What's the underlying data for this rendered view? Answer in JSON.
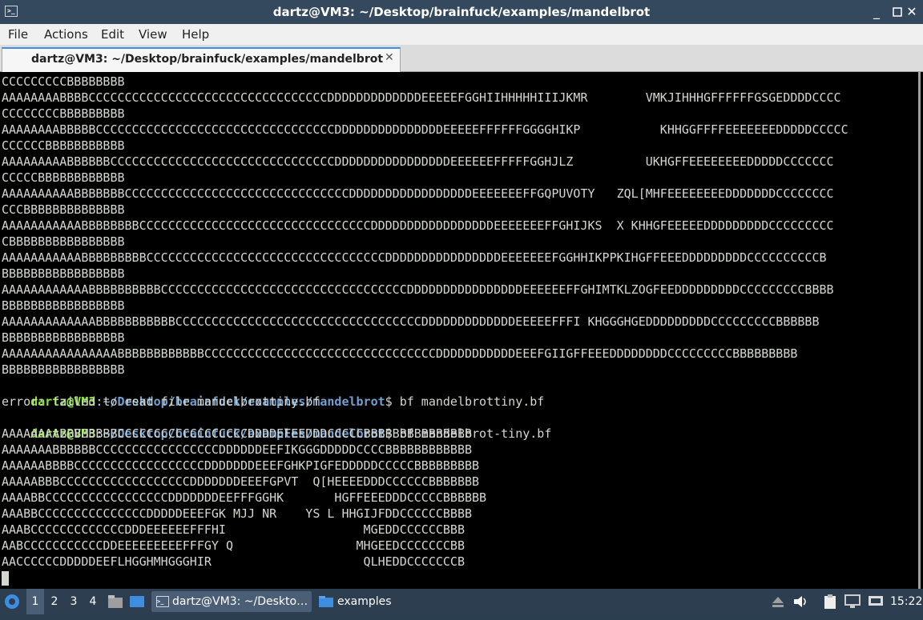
{
  "window": {
    "title": "dartz@VM3: ~/Desktop/brainfuck/examples/mandelbrot",
    "minimize": "_",
    "maximize": "▫",
    "close": "✕"
  },
  "menu": {
    "file": "File",
    "actions": "Actions",
    "edit": "Edit",
    "view": "View",
    "help": "Help"
  },
  "tab": {
    "label": "dartz@VM3: ~/Desktop/brainfuck/examples/mandelbrot",
    "close": "✕"
  },
  "terminal": {
    "lines": [
      "CCCCCCCCCBBBBBBBB",
      "AAAAAAAABBBBCCCCCCCCCCCCCCCCCCCCCCCCCCCCCCCCCDDDDDDDDDDDDDEEEEEFGGHIIHHHHHIIIJKMR        VMKJIHHHGFFFFFFGSGEDDDDCCCC",
      "CCCCCCCCBBBBBBBBB",
      "AAAAAAAABBBBBCCCCCCCCCCCCCCCCCCCCCCCCCCCCCCCCCDDDDDDDDDDDDDDDEEEEEFFFFFFGGGGHIKP           KHHGGFFFFEEEEEEEDDDDDCCCCC",
      "CCCCCCBBBBBBBBBBB",
      "AAAAAAAAABBBBBBCCCCCCCCCCCCCCCCCCCCCCCCCCCCCCCDDDDDDDDDDDDDDDDEEEEEEFFFFFGGHJLZ          UKHGFFEEEEEEEEDDDDDCCCCCCC",
      "CCCCCBBBBBBBBBBBB",
      "AAAAAAAAAABBBBBBBCCCCCCCCCCCCCCCCCCCCCCCCCCCCCCCDDDDDDDDDDDDDDDDDEEEEEEEFFGQPUVOTY   ZQL[MHFEEEEEEEEDDDDDDDCCCCCCCC",
      "CCCBBBBBBBBBBBBBB",
      "AAAAAAAAAAABBBBBBBBCCCCCCCCCCCCCCCCCCCCCCCCCCCCCCCCDDDDDDDDDDDDDDDDDEEEEEEEFFGHIJKS  X KHHGFEEEEEDDDDDDDDDCCCCCCCCC",
      "CBBBBBBBBBBBBBBBB",
      "AAAAAAAAAAABBBBBBBBBCCCCCCCCCCCCCCCCCCCCCCCCCCCCCCCCCDDDDDDDDDDDDDDDDEEEEEEEFGGHHIKPPKIHGFFEEEDDDDDDDDDCCCCCCCCCCB",
      "BBBBBBBBBBBBBBBBB",
      "AAAAAAAAAAAABBBBBBBBBBCCCCCCCCCCCCCCCCCCCCCCCCCCCCCCCCCCDDDDDDDDDDDDDDDDEEEEEEFFGHIMTKLZOGFEEDDDDDDDDDCCCCCCCCCBBBB",
      "BBBBBBBBBBBBBBBBB",
      "AAAAAAAAAAAAABBBBBBBBBBBCCCCCCCCCCCCCCCCCCCCCCCCCCCCCCCCCCDDDDDDDDDDDDDEEEEEFFFI KHGGGHGEDDDDDDDDDCCCCCCCCCBBBBBB",
      "BBBBBBBBBBBBBBBBB",
      "AAAAAAAAAAAAAAAABBBBBBBBBBBBCCCCCCCCCCCCCCCCCCCCCCCCCCCCCCCCDDDDDDDDDDDEEEFGIIGFFEEEDDDDDDDDCCCCCCCCCBBBBBBBBB",
      "BBBBBBBBBBBBBBBBB"
    ],
    "prompt1": {
      "user": "dartz@VM3",
      "path": "~/Desktop/brainfuck/examples/mandelbrot",
      "symbol": "$",
      "command": " bf mandelbrottiny.bf"
    },
    "error": "error: failed to read file mandelbrottiny.bf",
    "prompt2": {
      "user": "dartz@VM3",
      "path": "~/Desktop/brainfuck/examples/mandelbrot",
      "symbol": "$",
      "command": " bf mandelbrot-tiny.bf"
    },
    "tiny_lines": [
      "AAAAAAAABBBBBBBBCCCCCCCCCCCCCCCCCCDDDDEFEEDDDCCCCCBBBBBBBBBBBBBBB",
      "AAAAAAABBBBBBCCCCCCCCCCCCCCCCCDDDDDDEEFIKGGGDDDDDCCCCBBBBBBBBBBBB",
      "AAAAAABBBBCCCCCCCCCCCCCCCCCCDDDDDDDEEEFGHKPIGFEDDDDDCCCCCBBBBBBBBB",
      "AAAAABBBCCCCCCCCCCCCCCCCCCDDDDDDDEEEFGPVT  Q[HEEEEDDDCCCCCCBBBBBBB",
      "AAAABBCCCCCCCCCCCCCCCCCDDDDDDDEEFFFGGHK       HGFFEEEDDDCCCCCBBBBBB",
      "AAABBCCCCCCCCCCCCCCCDDDDDEEEFGK MJJ NR    YS L HHGIJFDDCCCCCCBBBB",
      "AAABCCCCCCCCCCCCCDDDEEEEEEFFFHI                   MGEDDCCCCCCBBB",
      "AABCCCCCCCCCCCDDEEEEEEEEEFFFGY Q                 MHGEEDCCCCCCCBB",
      "AACCCCCCDDDDDEEFLHGGHMHGGGHIR                     QLHEDDCCCCCCCB"
    ]
  },
  "taskbar": {
    "workspaces": [
      "1",
      "2",
      "3",
      "4"
    ],
    "terminal_task": "dartz@VM3: ~/Deskto…",
    "folder_task": "examples",
    "clock": "15:22"
  },
  "colors": {
    "user": "#8ae234",
    "path": "#729fcf",
    "text": "#d3d7cf",
    "titlebar": "#34495e",
    "taskbar": "#2c3e50"
  }
}
